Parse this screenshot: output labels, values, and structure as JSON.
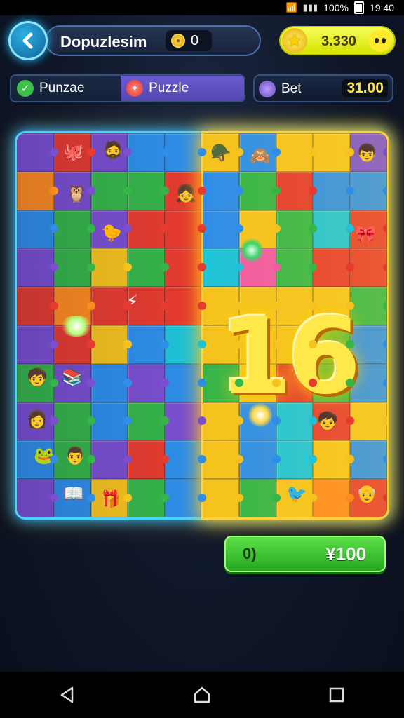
{
  "status_bar": {
    "battery": "100%",
    "time": "19:40"
  },
  "header": {
    "title": "Dopuzlesim",
    "coins": "0",
    "stars": "3.330"
  },
  "tabs": [
    {
      "label": "Punzae"
    },
    {
      "label": "Puzzle"
    }
  ],
  "bet": {
    "label": "Bet",
    "value": "31.00"
  },
  "board": {
    "number": "16",
    "piece_colors": [
      "#e63b2e",
      "#2f8ee8",
      "#36b548",
      "#f6c21d",
      "#7b4fd0",
      "#ff8a1e",
      "#1ec3d8",
      "#f25aa3"
    ]
  },
  "play_button": {
    "icon_text": "0)",
    "value": "¥100"
  },
  "colors": {
    "accent_cyan": "#2fb9ff",
    "accent_gold": "#ffd23a",
    "play_green": "#3ec434"
  }
}
